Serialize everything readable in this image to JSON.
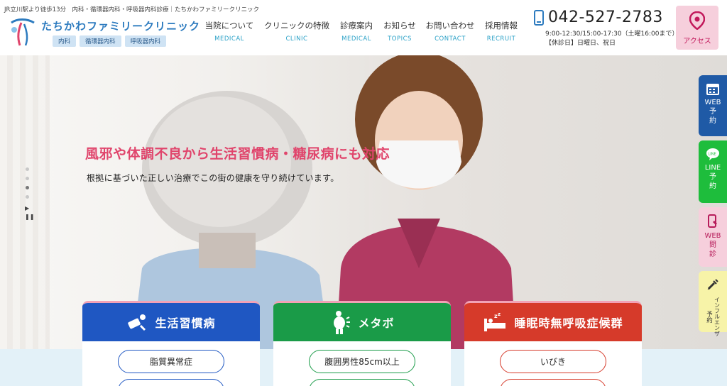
{
  "header": {
    "tagline": "JR立川駅より徒歩13分　内科・循環器内科・呼吸器内科診療｜たちかわファミリークリニック",
    "brand": "たちかわファミリークリニック",
    "dept_tags": [
      "内科",
      "循環器内科",
      "呼吸器内科"
    ],
    "phone": "042-527-2783",
    "hours_line1": "9:00-12:30/15:00-17:30（土曜16:00まで）",
    "hours_line2": "【休診日】日曜日、祝日",
    "access_label": "アクセス"
  },
  "nav": [
    {
      "jp": "当院について",
      "en": "MEDICAL"
    },
    {
      "jp": "クリニックの特徴",
      "en": "CLINIC"
    },
    {
      "jp": "診療案内",
      "en": "MEDICAL"
    },
    {
      "jp": "お知らせ",
      "en": "TOPICS"
    },
    {
      "jp": "お問い合わせ",
      "en": "CONTACT"
    },
    {
      "jp": "採用情報",
      "en": "RECRUIT"
    }
  ],
  "hero": {
    "headline": "風邪や体調不良から生活習慣病・糖尿病にも対応",
    "subline": "根拠に基づいた正しい治療でこの街の健康を守り続けています。"
  },
  "side_buttons": {
    "web_reserve": [
      "WEB",
      "予",
      "約"
    ],
    "line_reserve": [
      "LINE",
      "予",
      "約"
    ],
    "web_interview": [
      "WEB",
      "問",
      "診"
    ],
    "flu_reserve": [
      "インフルエンザ",
      "予約"
    ]
  },
  "cards": [
    {
      "title": "生活習慣病",
      "items": [
        "脂質異常症",
        ""
      ]
    },
    {
      "title": "メタボ",
      "items": [
        "腹囲男性85cm以上",
        ""
      ]
    },
    {
      "title": "睡眠時無呼吸症候群",
      "items": [
        "いびき",
        ""
      ]
    }
  ],
  "colors": {
    "brand_blue": "#2d7bbf",
    "headline_pink": "#e0456c",
    "card_blue": "#1f57c2",
    "card_green": "#1a9b48",
    "card_red": "#d63a2a",
    "line_green": "#1ebd3c",
    "web_blue": "#1f5aa6"
  }
}
